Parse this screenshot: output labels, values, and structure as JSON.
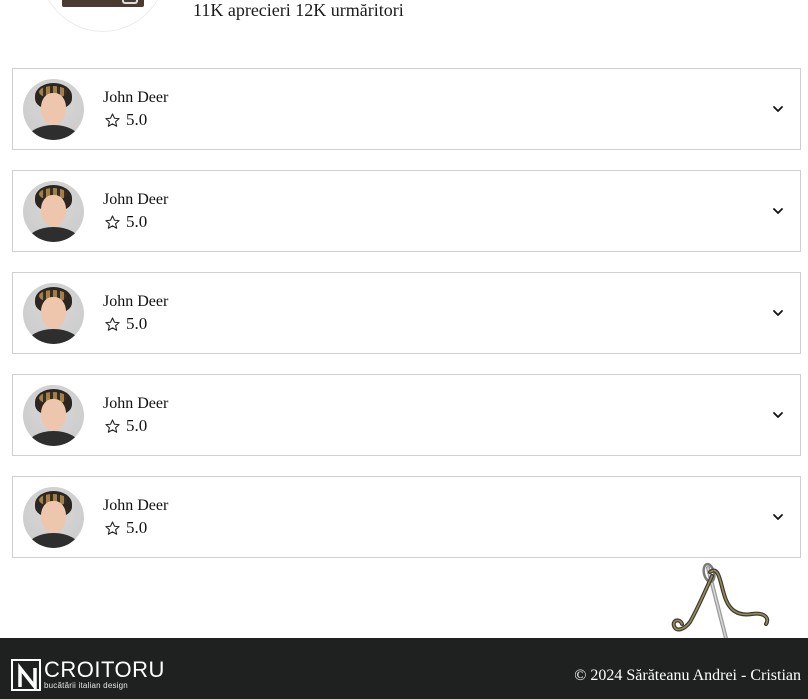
{
  "profile": {
    "stats": "11K aprecieri 12K urmăritori"
  },
  "reviews": [
    {
      "name": "John Deer",
      "rating": "5.0"
    },
    {
      "name": "John Deer",
      "rating": "5.0"
    },
    {
      "name": "John Deer",
      "rating": "5.0"
    },
    {
      "name": "John Deer",
      "rating": "5.0"
    },
    {
      "name": "John Deer",
      "rating": "5.0"
    }
  ],
  "icons": {
    "rating": "star-outline-icon",
    "expand": "chevron-down-icon"
  },
  "footer": {
    "logo_word": "CROITORU",
    "logo_tagline": "bucătării italian design",
    "logo_mark_text": "CROITORU",
    "copyright": "© 2024 Sărăteanu Andrei - Cristian"
  },
  "colors": {
    "footer_bg": "#1e2120",
    "card_border": "#cfcfcf"
  }
}
